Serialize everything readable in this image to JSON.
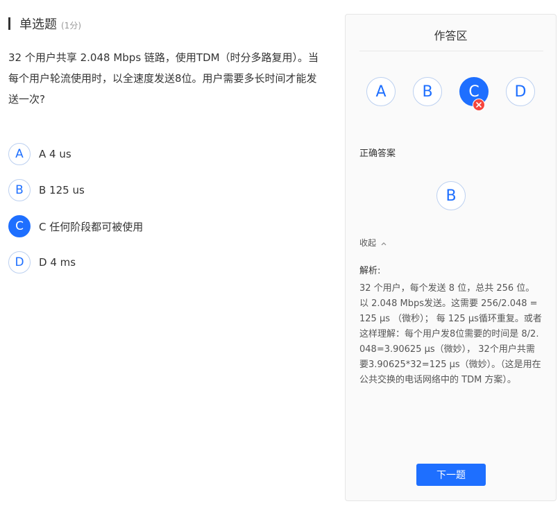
{
  "question": {
    "type": "单选题",
    "score": "(1分)",
    "text": "32 个用户共享 2.048 Mbps 链路，使用TDM（时分多路复用）。当每个用户轮流使用时，以全速度发送8位。用户需要多长时间才能发送一次?",
    "selected": "C",
    "options": [
      {
        "letter": "A",
        "text": "A 4 us"
      },
      {
        "letter": "B",
        "text": "B 125 us"
      },
      {
        "letter": "C",
        "text": "C 任何阶段都可被使用"
      },
      {
        "letter": "D",
        "text": "D 4 ms"
      }
    ]
  },
  "answer_panel": {
    "title": "作答区",
    "choices": [
      "A",
      "B",
      "C",
      "D"
    ],
    "selected": "C",
    "selected_status": "wrong",
    "correct_label": "正确答案",
    "correct_answer": "B",
    "collapse_label": "收起",
    "analysis_label": "解析:",
    "analysis_text": "32 个用户，每个发送 8 位，总共 256 位。以 2.048 Mbps发送。这需要 256/2.048 = 125 μs （微秒）； 每 125 μs循环重复。或者这样理解：每个用户发8位需要的时间是 8/2.048=3.90625 μs（微妙）， 32个用户共需要3.90625*32=125 μs（微妙）。（这是用在公共交换的电话网络中的 TDM 方案）。",
    "next_button": "下一题"
  },
  "colors": {
    "accent": "#1e6fff",
    "wrong": "#f5453d",
    "border": "#bcd0f0"
  }
}
